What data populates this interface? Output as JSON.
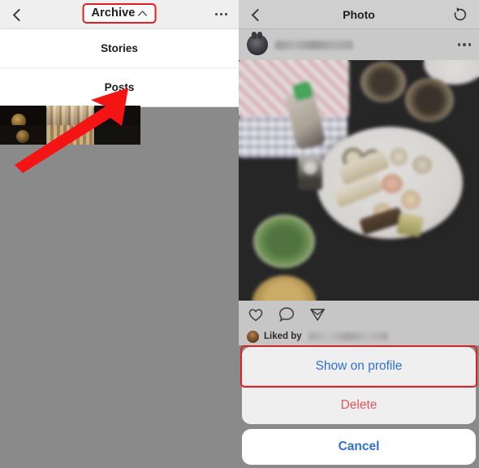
{
  "left_panel": {
    "header": {
      "back_icon": "back-chevron-icon",
      "title": "Archive",
      "dropdown_icon": "chevron-up-icon",
      "more_icon": "more-options-icon",
      "highlight_color": "#e02020"
    },
    "menu": {
      "items": [
        {
          "label": "Stories"
        },
        {
          "label": "Posts"
        }
      ]
    },
    "annotation": {
      "arrow_icon": "red-arrow-pointer",
      "arrow_color": "#f41414",
      "points_to": "Posts"
    }
  },
  "right_panel": {
    "header": {
      "back_icon": "back-chevron-icon",
      "title": "Photo",
      "restore_icon": "restore-archive-icon"
    },
    "post": {
      "avatar": "user-avatar",
      "username": "",
      "more_icon": "post-more-options-icon",
      "photo_alt": "sushi-meal-photo",
      "actions": [
        {
          "icon": "heart-icon"
        },
        {
          "icon": "comment-icon"
        },
        {
          "icon": "share-icon"
        }
      ],
      "liked_by_label": "Liked by",
      "liked_by_user": ""
    },
    "action_sheet": {
      "buttons": [
        {
          "label": "Show on profile",
          "color": "#2e6fd8",
          "highlighted": true
        },
        {
          "label": "Delete",
          "color": "#e8545e",
          "highlighted": false
        }
      ],
      "cancel_label": "Cancel",
      "cancel_color": "#2e6fd8",
      "highlight_color": "#e02020"
    }
  }
}
